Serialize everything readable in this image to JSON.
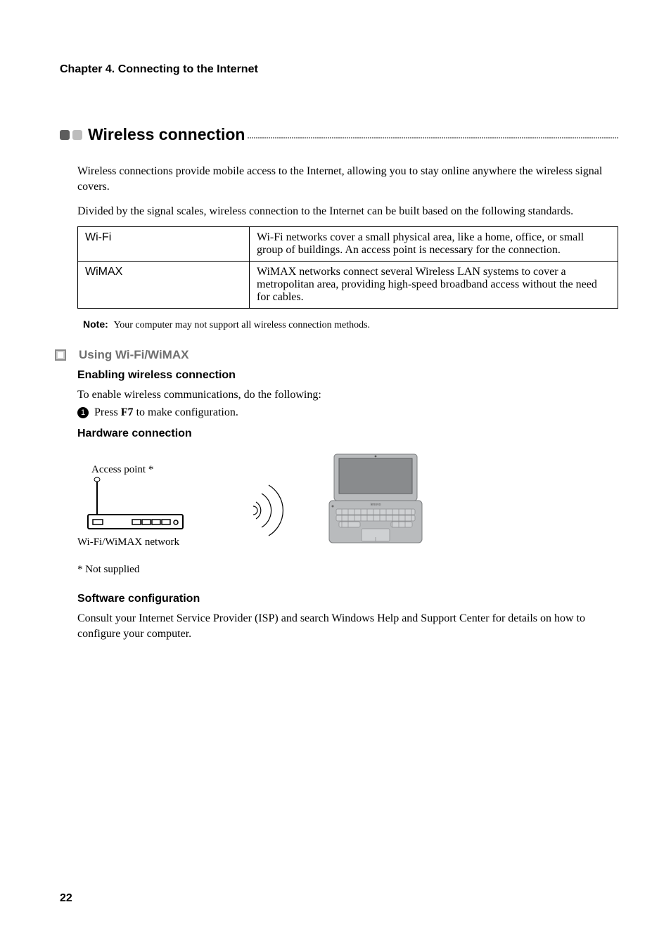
{
  "chapter_heading": "Chapter 4. Connecting to the Internet",
  "section": {
    "title": "Wireless connection",
    "intro_p1": "Wireless connections provide mobile access to the Internet, allowing you to stay online anywhere the wireless signal covers.",
    "intro_p2": "Divided by the signal scales, wireless connection to the Internet can be built based on the following standards."
  },
  "standards_table": [
    {
      "name": "Wi-Fi",
      "desc": "Wi-Fi networks cover a small physical area, like a home, office, or small group of buildings. An access point is necessary for the connection."
    },
    {
      "name": "WiMAX",
      "desc": "WiMAX networks connect several Wireless LAN systems to cover a metropolitan area, providing high-speed broadband access without the need for cables."
    }
  ],
  "note": {
    "label": "Note:",
    "text": "Your computer may not support all wireless connection methods."
  },
  "using": {
    "heading": "Using Wi-Fi/WiMAX",
    "enable_heading": "Enabling wireless connection",
    "enable_text": "To enable wireless communications, do the following:",
    "step1_num": "1",
    "step1_pre": "Press ",
    "step1_key": "F7",
    "step1_post": " to make configuration.",
    "hardware_heading": "Hardware connection",
    "ap_label": "Access point *",
    "net_label": "Wi-Fi/WiMAX network",
    "not_supplied": "* Not supplied",
    "software_heading": "Software configuration",
    "software_text": "Consult your Internet Service Provider (ISP) and search Windows Help and Support Center for details on how to configure your computer."
  },
  "page_number": "22"
}
